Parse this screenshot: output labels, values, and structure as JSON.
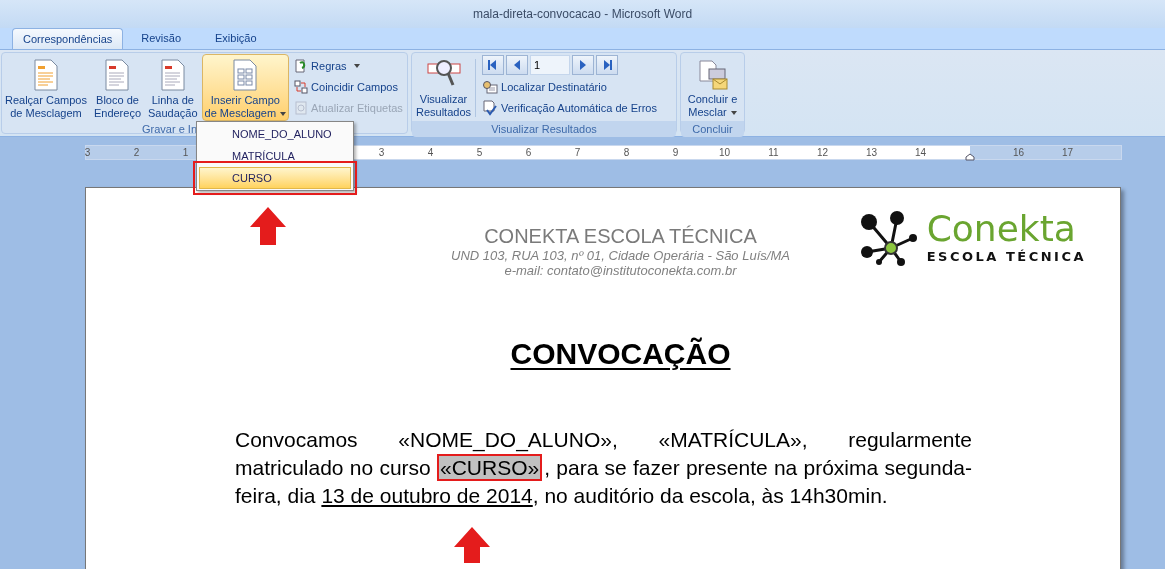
{
  "window": {
    "title": "mala-direta-convocacao - Microsoft Word"
  },
  "tabs": [
    {
      "label": "Correspondências",
      "selected": true
    },
    {
      "label": "Revisão",
      "selected": false
    },
    {
      "label": "Exibição",
      "selected": false
    }
  ],
  "write_insert_group": {
    "label": "Gravar e In",
    "large_buttons": [
      {
        "label": "Realçar Campos\nde Mesclagem",
        "selected": false,
        "has_menu": false
      },
      {
        "label": "Bloco de\nEndereço",
        "selected": false,
        "has_menu": false
      },
      {
        "label": "Linha de\nSaudação",
        "selected": false,
        "has_menu": false
      },
      {
        "label": "Inserir Campo\nde Mesclagem",
        "selected": true,
        "has_menu": true
      }
    ],
    "small_buttons": [
      {
        "label": "Regras",
        "has_menu": true,
        "disabled": false
      },
      {
        "label": "Coincidir Campos",
        "has_menu": false,
        "disabled": false
      },
      {
        "label": "Atualizar Etiquetas",
        "has_menu": false,
        "disabled": true
      }
    ]
  },
  "preview_group": {
    "label": "Visualizar Resultados",
    "large_button": {
      "label": "Visualizar\nResultados"
    },
    "record_field": {
      "value": "1"
    },
    "small_buttons": [
      {
        "label": "Localizar Destinatário"
      },
      {
        "label": "Verificação Automática de Erros"
      }
    ]
  },
  "finish_group": {
    "label": "Concluir",
    "large_button": {
      "label": "Concluir e\nMesclar",
      "has_menu": true
    }
  },
  "merge_field_menu": {
    "items": [
      {
        "label": "NOME_DO_ALUNO",
        "selected": false,
        "callout": false
      },
      {
        "label": "MATRÍCULA",
        "selected": false,
        "callout": false
      },
      {
        "label": "CURSO",
        "selected": true,
        "callout": true
      }
    ]
  },
  "ruler": {
    "left_labels": [
      "3",
      "2",
      "1"
    ],
    "right_labels": [
      "3",
      "4",
      "5",
      "6",
      "7",
      "8",
      "9",
      "10",
      "11",
      "12",
      "13",
      "14"
    ],
    "outer_labels": [
      "16",
      "17"
    ]
  },
  "document": {
    "logo": {
      "name": "Conekta",
      "tagline": "ESCOLA TÉCNICA"
    },
    "header": {
      "title": "CONEKTA ESCOLA TÉCNICA",
      "address": "UND 103, RUA 103, nº 01, Cidade Operária - São Luís/MA",
      "email": "e-mail: contato@institutoconekta.com.br"
    },
    "heading": "CONVOCAÇÃO",
    "body": [
      {
        "kind": "text",
        "text": "Convocamos "
      },
      {
        "kind": "field",
        "text": "«NOME_DO_ALUNO»",
        "highlighted": false
      },
      {
        "kind": "text",
        "text": ", "
      },
      {
        "kind": "field",
        "text": "«MATRÍCULA»",
        "highlighted": false
      },
      {
        "kind": "text",
        "text": ", regularmente matriculado no curso "
      },
      {
        "kind": "field",
        "text": "«CURSO»",
        "highlighted": true,
        "callout": true
      },
      {
        "kind": "text",
        "text": ", para se fazer presente na próxima segunda-feira, dia "
      },
      {
        "kind": "underlined",
        "text": "13 de outubro de 2014"
      },
      {
        "kind": "text",
        "text": ", no auditório da escola, às 14h30min."
      }
    ]
  }
}
